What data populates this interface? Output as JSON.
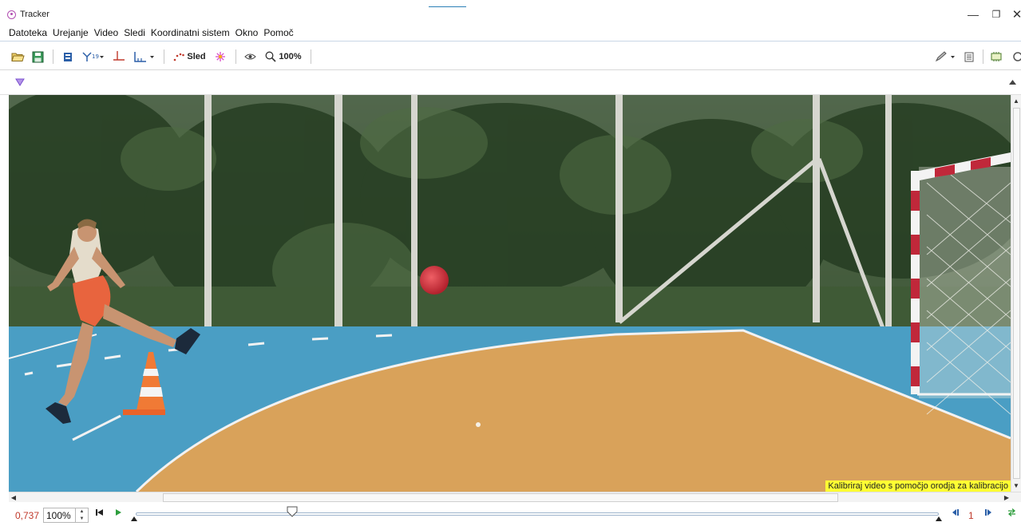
{
  "window": {
    "title": "Tracker",
    "minimize_glyph": "—",
    "maximize_glyph": "❐",
    "close_glyph": "✕"
  },
  "menu": [
    "Datoteka",
    "Urejanje",
    "Video",
    "Sledi",
    "Koordinatni sistem",
    "Okno",
    "Pomoč"
  ],
  "toolbar": {
    "track_button_label": "Sled",
    "zoom_label": "100%"
  },
  "video": {
    "calibration_hint": "Kalibriraj video s pomočjo orodja za kalibracijo"
  },
  "player": {
    "time": "0,737",
    "rate": "100%",
    "frame": "1",
    "slider_position": 0.195
  },
  "colors": {
    "accent": "#2b7fb7",
    "time_red": "#c0392b",
    "court_blue": "#4a9ec4",
    "court_orange": "#d9a25a",
    "hint_yellow": "#ffff33"
  },
  "icons": [
    "tracker-logo-icon",
    "open-folder-icon",
    "save-icon",
    "clip-settings-icon",
    "calibration-tools-icon",
    "axes-icon",
    "coordinate-system-icon",
    "track-icon",
    "autotracker-icon",
    "visibility-icon",
    "zoom-icon",
    "pencil-icon",
    "notes-icon",
    "memory-icon",
    "refresh-icon",
    "track-control-icon",
    "collapse-icon",
    "step-back-icon",
    "play-icon",
    "prev-step-icon",
    "next-step-icon",
    "loop-icon"
  ]
}
